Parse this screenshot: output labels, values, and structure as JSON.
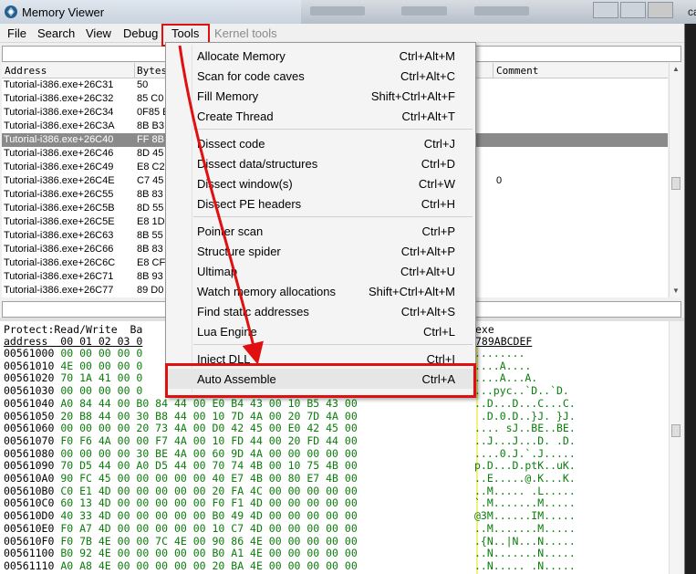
{
  "window": {
    "title": "Memory Viewer"
  },
  "background_window": {
    "partial_text": "ca"
  },
  "menu": {
    "items": [
      {
        "label": "File",
        "disabled": false
      },
      {
        "label": "Search",
        "disabled": false
      },
      {
        "label": "View",
        "disabled": false
      },
      {
        "label": "Debug",
        "disabled": false
      },
      {
        "label": "Tools",
        "disabled": false
      },
      {
        "label": "Kernel tools",
        "disabled": true
      }
    ]
  },
  "disasm": {
    "headers": {
      "address": "Address",
      "bytes": "Bytes",
      "comment": "Comment"
    },
    "rows": [
      {
        "address": "Tutorial-i386.exe+26C31",
        "bytes": "50"
      },
      {
        "address": "Tutorial-i386.exe+26C32",
        "bytes": "85 C0"
      },
      {
        "address": "Tutorial-i386.exe+26C34",
        "bytes": "0F85 E"
      },
      {
        "address": "Tutorial-i386.exe+26C3A",
        "bytes": "8B B3"
      },
      {
        "address": "Tutorial-i386.exe+26C40",
        "bytes": "FF 8B"
      },
      {
        "address": "Tutorial-i386.exe+26C46",
        "bytes": "8D 45"
      },
      {
        "address": "Tutorial-i386.exe+26C49",
        "bytes": "E8 C2"
      },
      {
        "address": "Tutorial-i386.exe+26C4E",
        "bytes": "C7 45"
      },
      {
        "address": "Tutorial-i386.exe+26C55",
        "bytes": "8B 83"
      },
      {
        "address": "Tutorial-i386.exe+26C5B",
        "bytes": "8D 55"
      },
      {
        "address": "Tutorial-i386.exe+26C5E",
        "bytes": "E8 1D"
      },
      {
        "address": "Tutorial-i386.exe+26C63",
        "bytes": "8B 55"
      },
      {
        "address": "Tutorial-i386.exe+26C66",
        "bytes": "8B 83"
      },
      {
        "address": "Tutorial-i386.exe+26C6C",
        "bytes": "E8 CF"
      },
      {
        "address": "Tutorial-i386.exe+26C71",
        "bytes": "8B 93"
      },
      {
        "address": "Tutorial-i386.exe+26C77",
        "bytes": "89 D0"
      }
    ],
    "selected_index": 4,
    "extra_value": "0"
  },
  "hexview": {
    "info_text": "Protect:Read/Write  Ba",
    "info_suffix": "exe",
    "column_header": "address  00 01 02 03 0",
    "ascii_header": "789ABCDEF",
    "rows": [
      {
        "address": "00561000",
        "bytes": "00 00 00 00 0",
        "ascii": "........"
      },
      {
        "address": "00561010",
        "bytes": "4E 00 00 00 0",
        "ascii": "....A...."
      },
      {
        "address": "00561020",
        "bytes": "70 1A 41 00 0",
        "ascii": "....A...A."
      },
      {
        "address": "00561030",
        "bytes": "00 00 00 00 0",
        "ascii": "...pyc..`D..`D."
      },
      {
        "address": "00561040",
        "bytes": "A0 84 44 00 B0 84 44 00 E0 B4 43 00 10 B5 43 00",
        "ascii": "..D...D...C...C."
      },
      {
        "address": "00561050",
        "bytes": "20 B8 44 00 30 B8 44 00 10 7D 4A 00 20 7D 4A 00",
        "ascii": " .D.0.D..}J. }J."
      },
      {
        "address": "00561060",
        "bytes": "00 00 00 00 20 73 4A 00 D0 42 45 00 E0 42 45 00",
        "ascii": ".... sJ..BE..BE."
      },
      {
        "address": "00561070",
        "bytes": "F0 F6 4A 00 00 F7 4A 00 10 FD 44 00 20 FD 44 00",
        "ascii": "..J...J...D. .D."
      },
      {
        "address": "00561080",
        "bytes": "00 00 00 00 30 BE 4A 00 60 9D 4A 00 00 00 00 00",
        "ascii": "....0.J.`.J....."
      },
      {
        "address": "00561090",
        "bytes": "70 D5 44 00 A0 D5 44 00 70 74 4B 00 10 75 4B 00",
        "ascii": "p.D...D.ptK..uK."
      },
      {
        "address": "005610A0",
        "bytes": "90 FC 45 00 00 00 00 00 40 E7 4B 00 80 E7 4B 00",
        "ascii": "..E.....@.K...K."
      },
      {
        "address": "005610B0",
        "bytes": "C0 E1 4D 00 00 00 00 00 20 FA 4C 00 00 00 00 00",
        "ascii": "..M..... .L....."
      },
      {
        "address": "005610C0",
        "bytes": "60 13 4D 00 00 00 00 00 F0 F1 4D 00 00 00 00 00",
        "ascii": "`.M.......M....."
      },
      {
        "address": "005610D0",
        "bytes": "40 33 4D 00 00 00 00 00 B0 49 4D 00 00 00 00 00",
        "ascii": "@3M......IM....."
      },
      {
        "address": "005610E0",
        "bytes": "F0 A7 4D 00 00 00 00 00 10 C7 4D 00 00 00 00 00",
        "ascii": "..M.......M....."
      },
      {
        "address": "005610F0",
        "bytes": "F0 7B 4E 00 00 7C 4E 00 90 86 4E 00 00 00 00 00",
        "ascii": ".{N..|N...N....."
      },
      {
        "address": "00561100",
        "bytes": "B0 92 4E 00 00 00 00 00 B0 A1 4E 00 00 00 00 00",
        "ascii": "..N.......N....."
      },
      {
        "address": "00561110",
        "bytes": "A0 A8 4E 00 00 00 00 00 20 BA 4E 00 00 00 00 00",
        "ascii": "..N..... .N....."
      }
    ]
  },
  "tools_menu": {
    "groups": [
      [
        {
          "label": "Allocate Memory",
          "shortcut": "Ctrl+Alt+M"
        },
        {
          "label": "Scan for code caves",
          "shortcut": "Ctrl+Alt+C"
        },
        {
          "label": "Fill Memory",
          "shortcut": "Shift+Ctrl+Alt+F"
        },
        {
          "label": "Create Thread",
          "shortcut": "Ctrl+Alt+T"
        }
      ],
      [
        {
          "label": "Dissect code",
          "shortcut": "Ctrl+J"
        },
        {
          "label": "Dissect data/structures",
          "shortcut": "Ctrl+D"
        },
        {
          "label": "Dissect window(s)",
          "shortcut": "Ctrl+W"
        },
        {
          "label": "Dissect PE headers",
          "shortcut": "Ctrl+H"
        }
      ],
      [
        {
          "label": "Pointer scan",
          "shortcut": "Ctrl+P"
        },
        {
          "label": "Structure spider",
          "shortcut": "Ctrl+Alt+P"
        },
        {
          "label": "Ultimap",
          "shortcut": "Ctrl+Alt+U"
        },
        {
          "label": "Watch memory allocations",
          "shortcut": "Shift+Ctrl+Alt+M"
        },
        {
          "label": "Find static addresses",
          "shortcut": "Ctrl+Alt+S"
        },
        {
          "label": "Lua Engine",
          "shortcut": "Ctrl+L"
        }
      ],
      [
        {
          "label": "Inject DLL",
          "shortcut": "Ctrl+I"
        },
        {
          "label": "Auto Assemble",
          "shortcut": "Ctrl+A"
        }
      ]
    ],
    "highlighted": "Auto Assemble"
  },
  "annotation": {
    "highlight_color": "#e01010"
  }
}
